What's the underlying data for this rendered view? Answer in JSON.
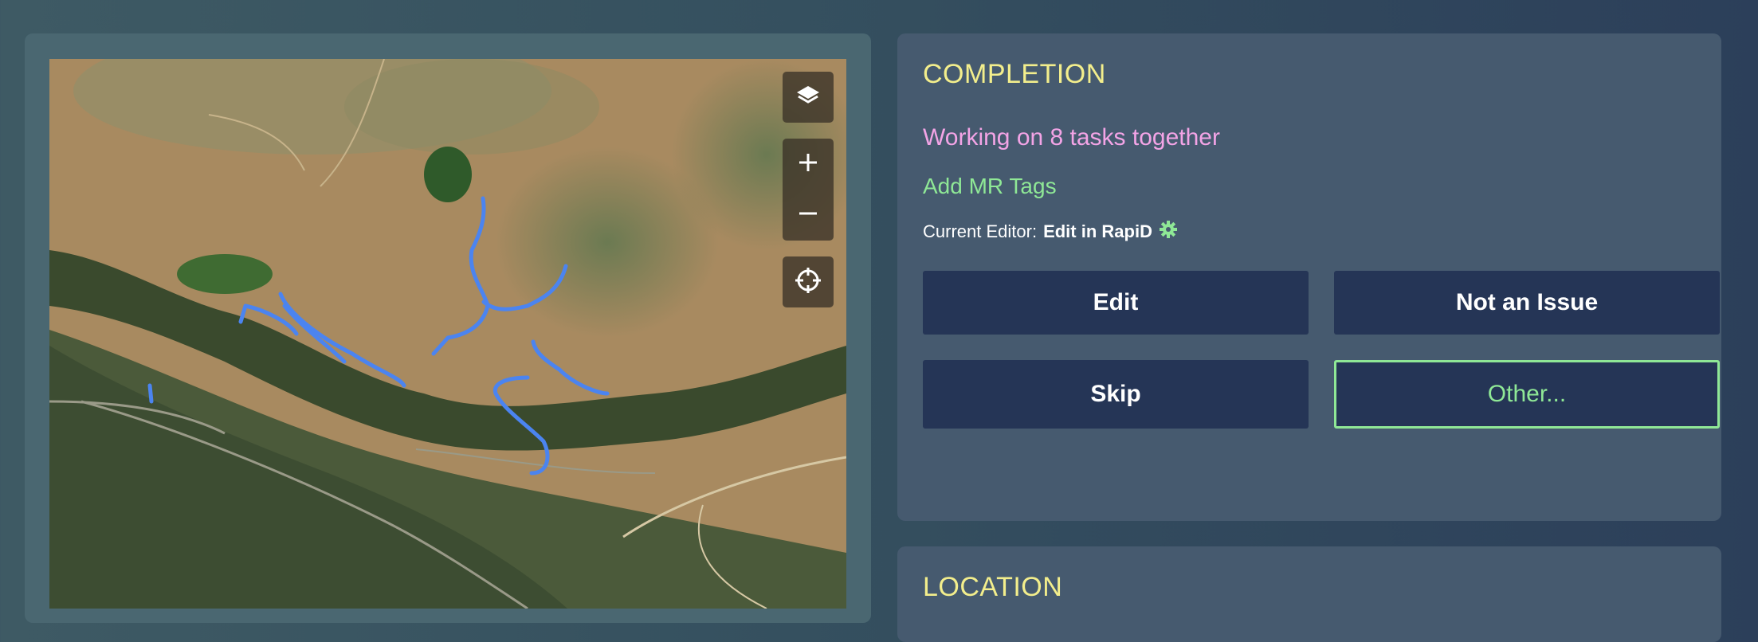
{
  "completion": {
    "title": "COMPLETION",
    "working_text": "Working on 8 tasks together",
    "add_tags": "Add MR Tags",
    "editor_label": "Current Editor:",
    "editor_value": "Edit in RapiD",
    "buttons": {
      "edit": "Edit",
      "not_issue": "Not an Issue",
      "skip": "Skip",
      "other": "Other..."
    }
  },
  "location": {
    "title": "LOCATION"
  },
  "map": {
    "icons": [
      "layers-icon",
      "zoom-in-icon",
      "zoom-out-icon",
      "locate-icon"
    ],
    "task_line_color": "#4b84f0"
  },
  "colors": {
    "accent_yellow": "#f3ee8c",
    "accent_pink": "#f3a4e6",
    "accent_green": "#8fe896",
    "button_bg": "#253556"
  }
}
